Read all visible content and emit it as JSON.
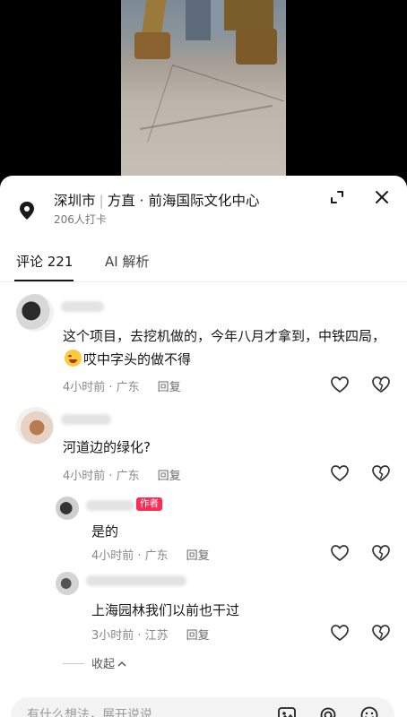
{
  "location": {
    "city": "深圳市",
    "separator": "|",
    "place": "方直 · 前海国际文化中心",
    "checkins": "206人打卡"
  },
  "tabs": [
    {
      "label": "评论 221",
      "active": true
    },
    {
      "label": "AI 解析",
      "active": false
    }
  ],
  "comments": [
    {
      "text_a": "这个项目，去挖机做的，今年八月才拿到，中铁四局，",
      "emoji": "crying-laughing-emoji",
      "text_b": "哎中字头的做不得",
      "time": "4小时前 · 广东",
      "reply": "回复"
    },
    {
      "text": "河道边的绿化?",
      "time": "4小时前 · 广东",
      "reply": "回复",
      "replies": [
        {
          "badge": "作者",
          "text": "是的",
          "time": "4小时前 · 广东",
          "reply": "回复"
        },
        {
          "text": "上海园林我们以前也干过",
          "time": "3小时前 · 江苏",
          "reply": "回复"
        }
      ],
      "collapse_label": "收起"
    }
  ],
  "input": {
    "placeholder": "有什么想法，展开说说"
  },
  "colors": {
    "accent": "#fe2c55",
    "text": "#161616",
    "meta": "#8a8a8a"
  }
}
